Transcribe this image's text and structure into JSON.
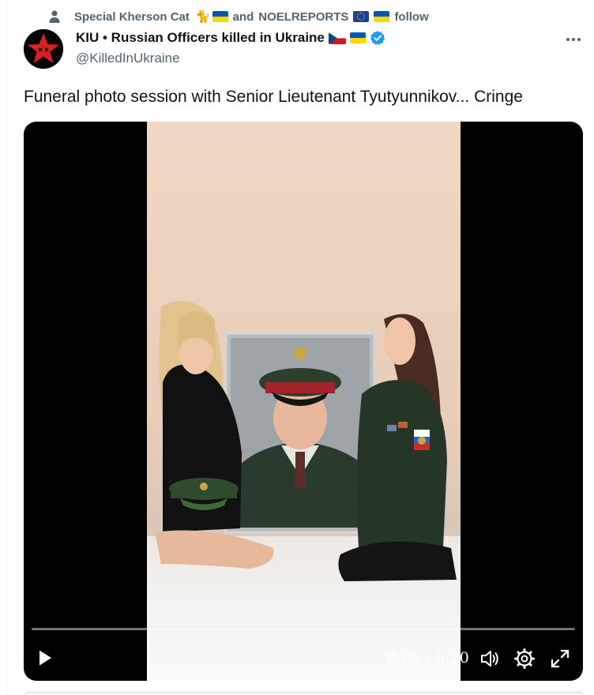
{
  "social_context": {
    "user1": "Special Kherson Cat",
    "connector": "and",
    "user2": "NOELREPORTS",
    "suffix": "follow"
  },
  "author": {
    "display_name": "KIU • Russian Officers killed in Ukraine",
    "handle": "@KilledInUkraine",
    "verified": true
  },
  "tweet": {
    "text": "Funeral photo session with Senior Lieutenant Tyutyunnikov... Cringe"
  },
  "video": {
    "time": "0:00 / 0:20",
    "progress": 0
  },
  "icons": [
    "person-icon",
    "cat-emoji",
    "ukraine-flag",
    "eu-flag",
    "czech-flag",
    "verified-icon",
    "more-icon",
    "play-icon",
    "volume-icon",
    "settings-icon",
    "fullscreen-icon"
  ],
  "colors": {
    "accent": "#1d9bf0",
    "secondary_text": "#536471",
    "primary_text": "#0f1419"
  }
}
